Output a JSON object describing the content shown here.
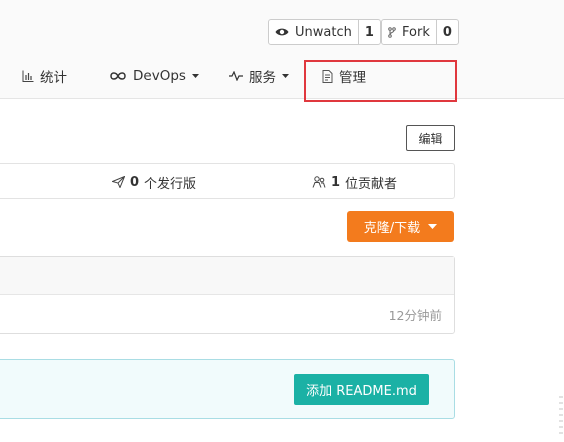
{
  "repo_actions": {
    "watch_label": "Unwatch",
    "watch_count": "1",
    "fork_label": "Fork",
    "fork_count": "0"
  },
  "nav": {
    "items": [
      {
        "label": "统计",
        "icon": "bar-chart-icon"
      },
      {
        "label": "DevOps",
        "icon": "infinity-icon"
      },
      {
        "label": "服务",
        "icon": "pulse-icon"
      },
      {
        "label": "管理",
        "icon": "document-icon"
      }
    ]
  },
  "toolbar": {
    "edit_label": "编辑"
  },
  "stats": {
    "releases_count": "0",
    "releases_label": "个发行版",
    "contributors_count": "1",
    "contributors_label": "位贡献者"
  },
  "clone": {
    "label": "克隆/下载"
  },
  "files": {
    "last_commit_time": "12分钟前"
  },
  "readme": {
    "add_label": "添加 README.md"
  },
  "colors": {
    "highlight": "#e0383e",
    "clone_button": "#f37b1d",
    "readme_button": "#1bb1a5"
  }
}
